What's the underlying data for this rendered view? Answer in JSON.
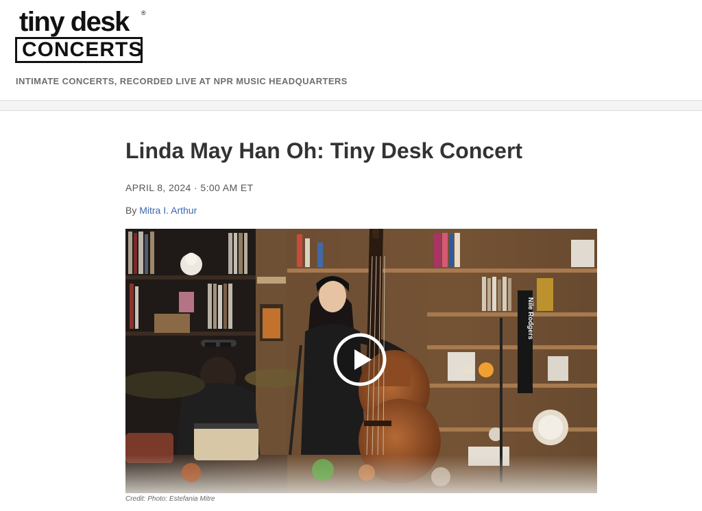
{
  "brand": {
    "logo_top": "tiny desk",
    "logo_bottom": "CONCERTS",
    "registered_mark": "®",
    "tagline": "INTIMATE CONCERTS, RECORDED LIVE AT NPR MUSIC HEADQUARTERS"
  },
  "article": {
    "title": "Linda May Han Oh: Tiny Desk Concert",
    "date": "APRIL 8, 2024 · 5:00 AM ET",
    "byline_prefix": "By",
    "author": "Mitra I. Arthur"
  },
  "media": {
    "play_icon": "play-icon",
    "credit": "Credit: Photo: Estefania Mitre",
    "sign_text": "Nile Rodgers",
    "colors": {
      "wood": "#8a5a33",
      "wall": "#4a3626",
      "outfit": "#1c1c1c",
      "bass": "#8b4a22"
    }
  }
}
